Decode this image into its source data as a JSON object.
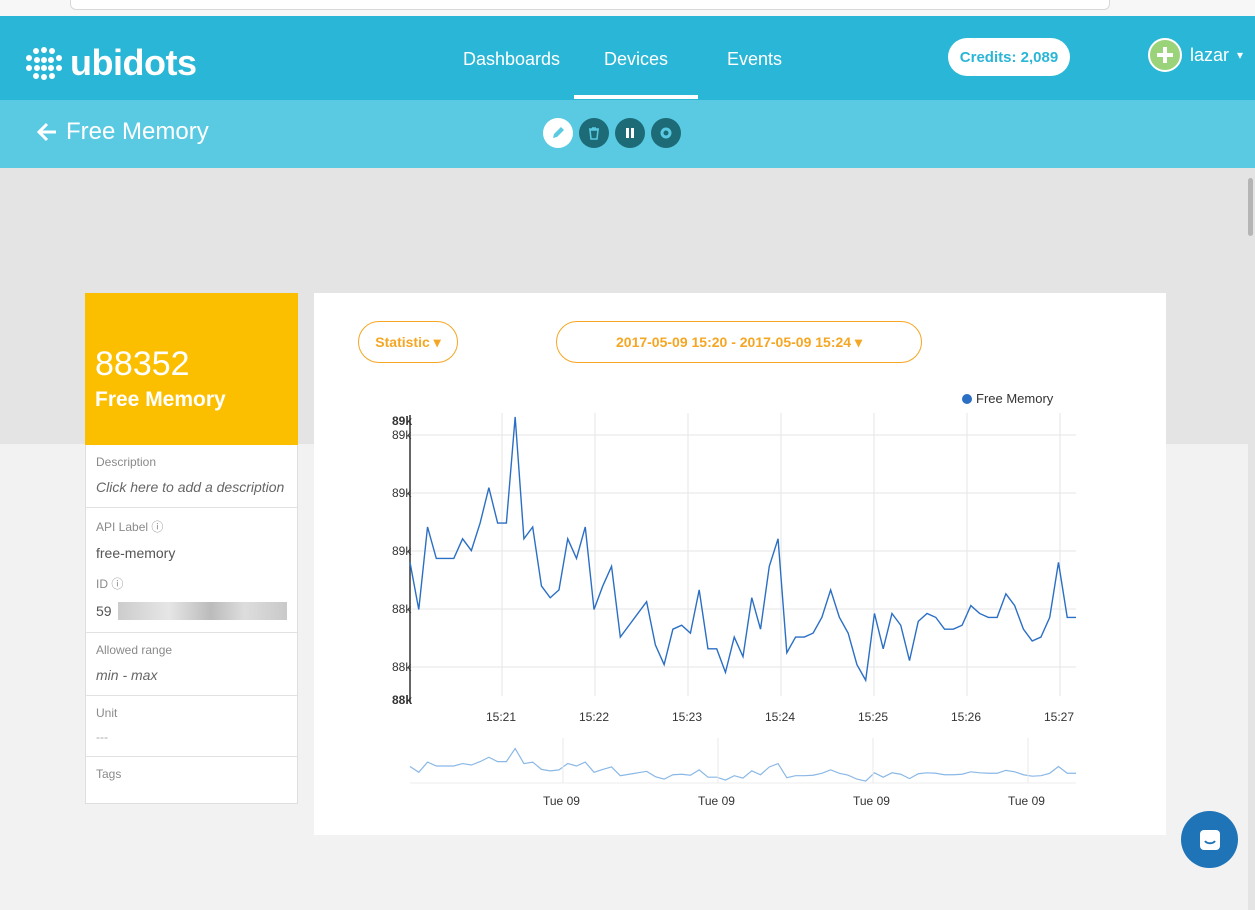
{
  "brand": {
    "name": "ubidots"
  },
  "nav": {
    "tabs": [
      {
        "label": "Dashboards"
      },
      {
        "label": "Devices"
      },
      {
        "label": "Events"
      }
    ],
    "active": "Devices"
  },
  "credits": "Credits: 2,089",
  "user": {
    "name": "lazar"
  },
  "subheader": {
    "title": "Free Memory",
    "back_icon": "arrow-left-icon",
    "actions": [
      "pencil-icon",
      "trash-icon",
      "pause-icon",
      "gear-icon"
    ]
  },
  "variable": {
    "value": "88352",
    "name": "Free Memory",
    "description_label": "Description",
    "description_placeholder": "Click here to add a description",
    "api_label_label": "API Label",
    "api_label": "free-memory",
    "id_label": "ID",
    "id_prefix": "59",
    "range_label": "Allowed range",
    "range_value": "min - max",
    "unit_label": "Unit",
    "unit_value": "---",
    "tags_label": "Tags"
  },
  "colors": {
    "primary": "#2ab6d6",
    "secondary": "#59cae2",
    "value_card": "#fcbf00",
    "accent": "#f5a623",
    "line": "#2b6fc4"
  },
  "controls": {
    "statistic": "Statistic",
    "date_range": "2017-05-09 15:20 - 2017-05-09 15:24"
  },
  "chart_data": {
    "type": "line",
    "series": [
      {
        "name": "Free Memory"
      }
    ],
    "x_ticks": [
      "15:21",
      "15:22",
      "15:23",
      "15:24",
      "15:25",
      "15:26",
      "15:27"
    ],
    "y_ticks": [
      "89k",
      "89k",
      "89k",
      "88k",
      "88k"
    ],
    "y_extremes": [
      "89k",
      "88k"
    ],
    "ylim": [
      88180,
      88900
    ],
    "grid": true,
    "legend": "top-right",
    "values": [
      88520,
      88400,
      88610,
      88530,
      88530,
      88530,
      88580,
      88550,
      88620,
      88710,
      88620,
      88620,
      88890,
      88580,
      88610,
      88460,
      88430,
      88450,
      88580,
      88530,
      88610,
      88400,
      88460,
      88510,
      88330,
      88360,
      88390,
      88420,
      88310,
      88260,
      88350,
      88360,
      88340,
      88450,
      88300,
      88300,
      88240,
      88330,
      88280,
      88430,
      88350,
      88510,
      88580,
      88290,
      88330,
      88330,
      88340,
      88380,
      88450,
      88380,
      88340,
      88260,
      88220,
      88390,
      88300,
      88390,
      88360,
      88270,
      88370,
      88390,
      88380,
      88350,
      88350,
      88360,
      88410,
      88390,
      88380,
      88380,
      88440,
      88410,
      88350,
      88320,
      88330,
      88380,
      88520,
      88380,
      88380
    ],
    "navigator_ticks": [
      "Tue 09",
      "Tue 09",
      "Tue 09",
      "Tue 09"
    ]
  }
}
